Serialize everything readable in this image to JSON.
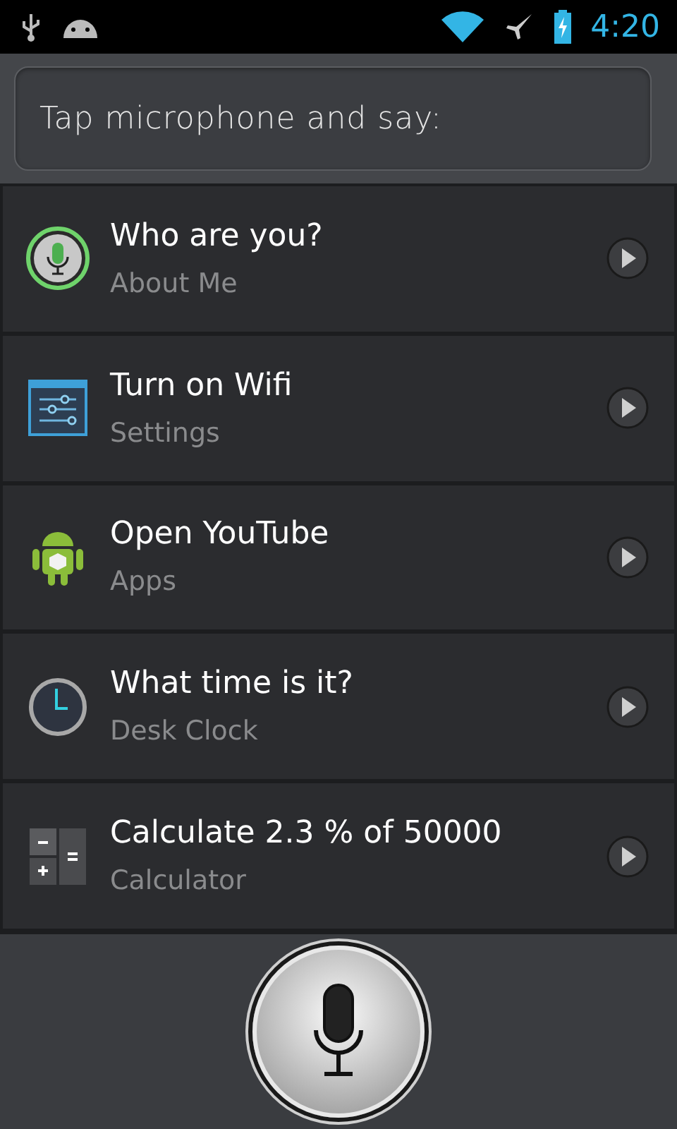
{
  "status_bar": {
    "time": "4:20"
  },
  "prompt": {
    "text": "Tap microphone and say:"
  },
  "suggestions": [
    {
      "kind": "mic",
      "title": "Who are you?",
      "subtitle": "About Me"
    },
    {
      "kind": "settings",
      "title": "Turn on Wifi",
      "subtitle": "Settings"
    },
    {
      "kind": "android",
      "title": "Open YouTube",
      "subtitle": "Apps"
    },
    {
      "kind": "clock",
      "title": "What time is it?",
      "subtitle": "Desk Clock"
    },
    {
      "kind": "calculator",
      "title": "Calculate 2.3 % of 50000",
      "subtitle": "Calculator"
    }
  ]
}
